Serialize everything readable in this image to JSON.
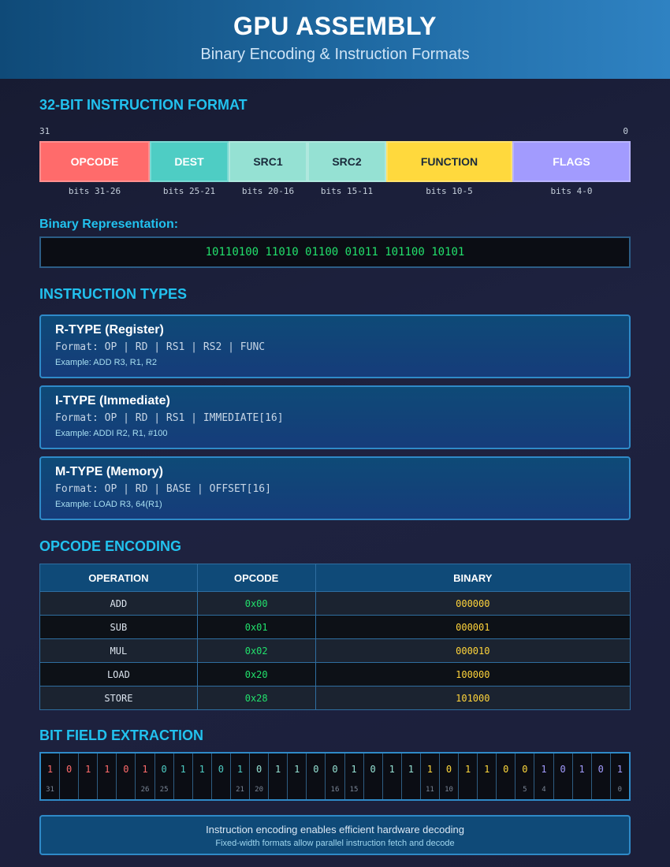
{
  "header": {
    "title": "GPU ASSEMBLY",
    "subtitle": "Binary Encoding & Instruction Formats"
  },
  "format": {
    "section_title": "32-BIT INSTRUCTION FORMAT",
    "bit_high": "31",
    "bit_low": "0",
    "fields": [
      {
        "name": "OPCODE",
        "bits": "bits 31-26",
        "color": "#ff6b6b",
        "text_color": "#ffffff"
      },
      {
        "name": "DEST",
        "bits": "bits 25-21",
        "color": "#4ecdc4",
        "text_color": "#ffffff"
      },
      {
        "name": "SRC1",
        "bits": "bits 20-16",
        "color": "#95e1d3",
        "text_color": "#1a2b3c"
      },
      {
        "name": "SRC2",
        "bits": "bits 15-11",
        "color": "#95e1d3",
        "text_color": "#1a2b3c"
      },
      {
        "name": "FUNCTION",
        "bits": "bits 10-5",
        "color": "#ffd93d",
        "text_color": "#1a2b3c"
      },
      {
        "name": "FLAGS",
        "bits": "bits 4-0",
        "color": "#a29bfe",
        "text_color": "#ffffff"
      }
    ],
    "binary_label": "Binary Representation:",
    "binary_value": "10110100 11010 01100 01011 101100 10101"
  },
  "types": {
    "section_title": "INSTRUCTION TYPES",
    "items": [
      {
        "title": "R-TYPE (Register)",
        "format": "Format: OP | RD | RS1 | RS2 | FUNC",
        "example": "Example: ADD R3, R1, R2"
      },
      {
        "title": "I-TYPE (Immediate)",
        "format": "Format: OP | RD | RS1 | IMMEDIATE[16]",
        "example": "Example: ADDI R2, R1, #100"
      },
      {
        "title": "M-TYPE (Memory)",
        "format": "Format: OP | RD | BASE | OFFSET[16]",
        "example": "Example: LOAD R3, 64(R1)"
      }
    ]
  },
  "opcodes": {
    "section_title": "OPCODE ENCODING",
    "headers": [
      "OPERATION",
      "OPCODE",
      "BINARY"
    ],
    "rows": [
      [
        "ADD",
        "0x00",
        "000000"
      ],
      [
        "SUB",
        "0x01",
        "000001"
      ],
      [
        "MUL",
        "0x02",
        "000010"
      ],
      [
        "LOAD",
        "0x20",
        "100000"
      ],
      [
        "STORE",
        "0x28",
        "101000"
      ]
    ]
  },
  "bitfield": {
    "section_title": "BIT FIELD EXTRACTION",
    "bits": [
      "1",
      "0",
      "1",
      "1",
      "0",
      "1",
      "0",
      "1",
      "1",
      "0",
      "1",
      "0",
      "1",
      "1",
      "0",
      "0",
      "1",
      "0",
      "1",
      "1",
      "1",
      "0",
      "1",
      "1",
      "0",
      "0",
      "1",
      "0",
      "1",
      "0",
      "1"
    ],
    "bit_labels": [
      "31",
      "",
      "",
      "",
      "",
      "26",
      "25",
      "",
      "",
      "",
      "21",
      "20",
      "",
      "",
      "",
      "16",
      "15",
      "",
      "",
      "",
      "11",
      "10",
      "",
      "",
      "",
      "5",
      "4",
      "",
      "",
      "",
      "0"
    ],
    "group_colors": [
      "#ff6b6b",
      "#ff6b6b",
      "#ff6b6b",
      "#ff6b6b",
      "#ff6b6b",
      "#ff6b6b",
      "#4ecdc4",
      "#4ecdc4",
      "#4ecdc4",
      "#4ecdc4",
      "#4ecdc4",
      "#95e1d3",
      "#95e1d3",
      "#95e1d3",
      "#95e1d3",
      "#95e1d3",
      "#95e1d3",
      "#95e1d3",
      "#95e1d3",
      "#95e1d3",
      "#ffd93d",
      "#ffd93d",
      "#ffd93d",
      "#ffd93d",
      "#ffd93d",
      "#ffd93d",
      "#a29bfe",
      "#a29bfe",
      "#a29bfe",
      "#a29bfe",
      "#a29bfe"
    ]
  },
  "footer": {
    "main": "Instruction encoding enables efficient hardware decoding",
    "sub": "Fixed-width formats allow parallel instruction fetch and decode"
  }
}
